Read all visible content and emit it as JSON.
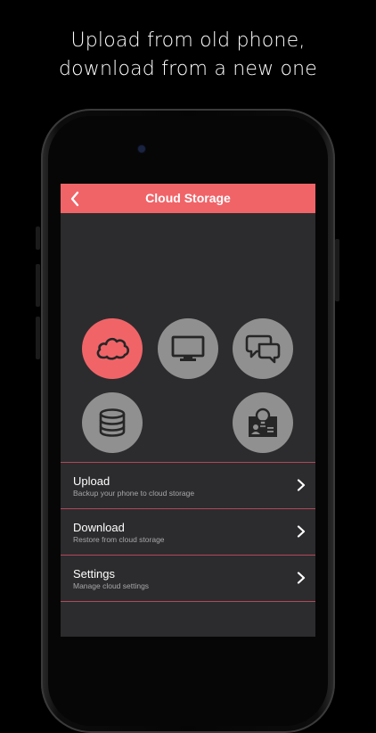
{
  "promo": {
    "line1": "Upload from old phone,",
    "line2": "download from a new one"
  },
  "app": {
    "title": "Cloud Storage",
    "back_icon": "chevron-left-icon",
    "accent_color": "#f06468",
    "background_color": "#2c2c2e"
  },
  "categories": [
    {
      "icon": "cloud-icon",
      "active": true
    },
    {
      "icon": "monitor-icon",
      "active": false
    },
    {
      "icon": "chat-bubbles-icon",
      "active": false
    },
    {
      "icon": "database-icon",
      "active": false
    },
    {
      "icon": "contact-card-icon",
      "active": false
    }
  ],
  "menu": [
    {
      "title": "Upload",
      "subtitle": "Backup your phone to cloud storage"
    },
    {
      "title": "Download",
      "subtitle": "Restore from cloud storage"
    },
    {
      "title": "Settings",
      "subtitle": "Manage cloud settings"
    }
  ]
}
